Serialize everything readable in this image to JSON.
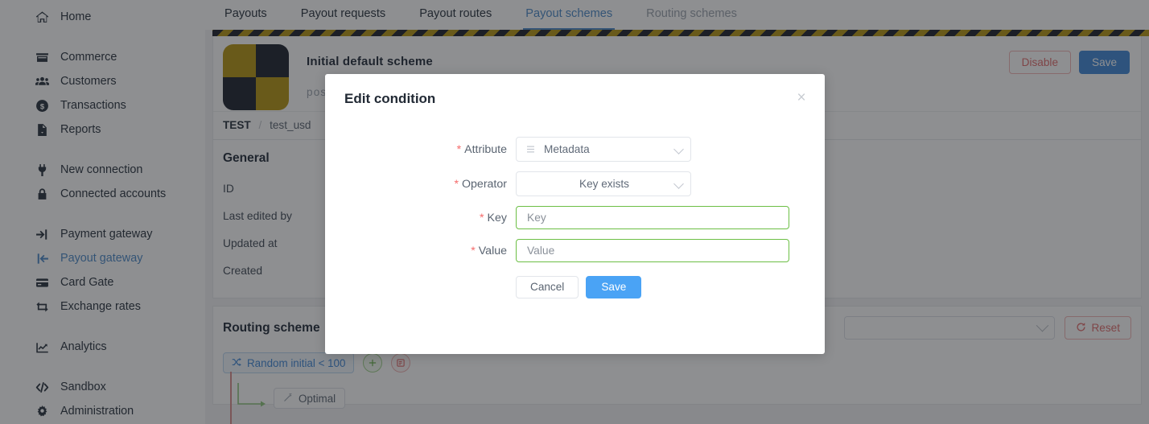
{
  "sidebar": {
    "groups": [
      {
        "items": [
          {
            "label": "Home",
            "icon": "home-icon",
            "active": false
          }
        ]
      },
      {
        "items": [
          {
            "label": "Commerce",
            "icon": "store-icon",
            "active": false
          },
          {
            "label": "Customers",
            "icon": "users-icon",
            "active": false
          },
          {
            "label": "Transactions",
            "icon": "dollar-circle-icon",
            "active": false
          },
          {
            "label": "Reports",
            "icon": "report-file-icon",
            "active": false
          }
        ]
      },
      {
        "items": [
          {
            "label": "New connection",
            "icon": "plug-icon",
            "active": false
          },
          {
            "label": "Connected accounts",
            "icon": "lock-icon",
            "active": false
          }
        ]
      },
      {
        "items": [
          {
            "label": "Payment gateway",
            "icon": "sign-in-icon",
            "active": false
          },
          {
            "label": "Payout gateway",
            "icon": "sign-out-icon",
            "active": true
          },
          {
            "label": "Card Gate",
            "icon": "credit-card-icon",
            "active": false
          },
          {
            "label": "Exchange rates",
            "icon": "exchange-icon",
            "active": false
          }
        ]
      },
      {
        "items": [
          {
            "label": "Analytics",
            "icon": "chart-line-icon",
            "active": false
          }
        ]
      },
      {
        "items": [
          {
            "label": "Sandbox",
            "icon": "code-icon",
            "active": false
          },
          {
            "label": "Administration",
            "icon": "gear-icon",
            "active": false
          }
        ]
      }
    ]
  },
  "tabs": [
    {
      "label": "Payouts",
      "state": "normal"
    },
    {
      "label": "Payout requests",
      "state": "normal"
    },
    {
      "label": "Payout routes",
      "state": "normal"
    },
    {
      "label": "Payout schemes",
      "state": "active"
    },
    {
      "label": "Routing schemes",
      "state": "muted"
    }
  ],
  "scheme": {
    "title": "Initial default scheme",
    "subtitle": "poscs",
    "disable_label": "Disable",
    "save_label": "Save",
    "breadcrumb": {
      "root": "TEST",
      "separator": "/",
      "current": "test_usd"
    }
  },
  "general": {
    "title": "General",
    "rows": [
      {
        "label": "ID"
      },
      {
        "label": "Last edited by"
      },
      {
        "label": "Updated at"
      },
      {
        "label": "Created"
      }
    ]
  },
  "routing": {
    "title": "Routing scheme",
    "select_value": "",
    "reset_label": "Reset",
    "tree": {
      "condition_chip": "Random initial < 100",
      "add_label": "+",
      "node_label": "Optimal"
    }
  },
  "modal": {
    "title": "Edit condition",
    "close_label": "×",
    "fields": [
      {
        "label": "Attribute",
        "required": true,
        "type": "select",
        "value": "Metadata",
        "icon": "list-icon",
        "align": "left"
      },
      {
        "label": "Operator",
        "required": true,
        "type": "select",
        "value": "Key exists",
        "icon": "",
        "align": "center"
      },
      {
        "label": "Key",
        "required": true,
        "type": "input",
        "placeholder": "Key"
      },
      {
        "label": "Value",
        "required": true,
        "type": "input",
        "placeholder": "Value"
      }
    ],
    "cancel_label": "Cancel",
    "save_label": "Save"
  },
  "colors": {
    "accent_blue": "#4a89c8",
    "primary_blue": "#3f87d6",
    "modal_save_blue": "#4aa3f5",
    "danger_red": "#e06a6a",
    "required_red": "#f56c6c",
    "input_green": "#6cbf45",
    "hazard_yellow": "#b59510",
    "hazard_dark": "#1b1f2b"
  }
}
